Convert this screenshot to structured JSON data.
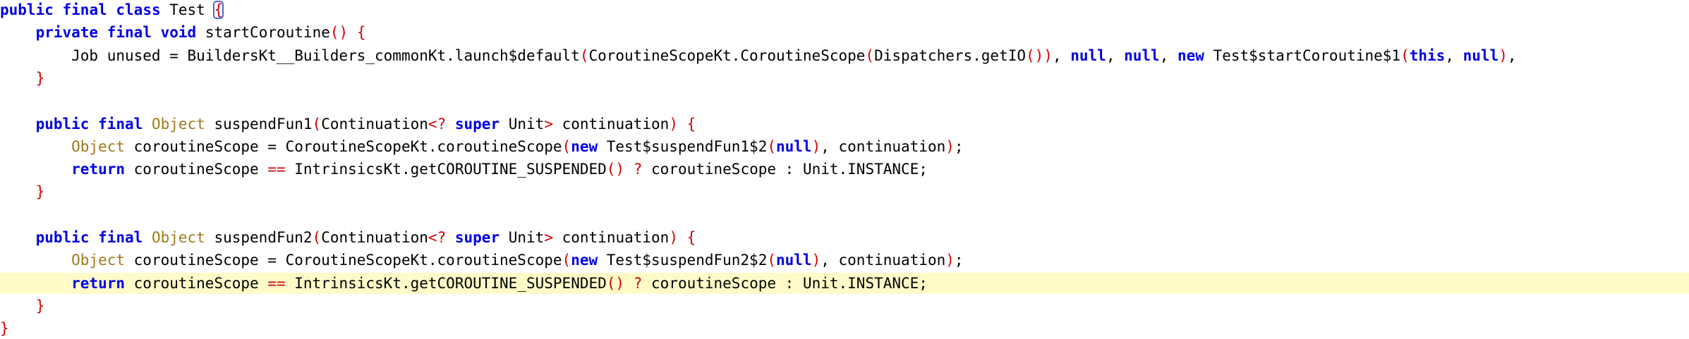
{
  "editor": {
    "current_line": 13,
    "colors": {
      "keyword": "#0000e6",
      "type": "#9e7a1c",
      "paren": "#d20000",
      "plain": "#000000",
      "current_line_bg": "#fffbc9",
      "bracket_match_box": "#4a66c8"
    },
    "lines": [
      [
        {
          "t": "kw",
          "v": "public"
        },
        {
          "t": "plain",
          "v": " "
        },
        {
          "t": "kw",
          "v": "final"
        },
        {
          "t": "plain",
          "v": " "
        },
        {
          "t": "kw",
          "v": "class"
        },
        {
          "t": "plain",
          "v": " Test "
        },
        {
          "t": "paren",
          "v": "{",
          "boxed": true
        }
      ],
      [
        {
          "t": "plain",
          "v": "    "
        },
        {
          "t": "kw",
          "v": "private"
        },
        {
          "t": "plain",
          "v": " "
        },
        {
          "t": "kw",
          "v": "final"
        },
        {
          "t": "plain",
          "v": " "
        },
        {
          "t": "kw",
          "v": "void"
        },
        {
          "t": "plain",
          "v": " startCoroutine"
        },
        {
          "t": "paren",
          "v": "()"
        },
        {
          "t": "plain",
          "v": " "
        },
        {
          "t": "paren",
          "v": "{"
        }
      ],
      [
        {
          "t": "plain",
          "v": "        Job unused = BuildersKt__Builders_commonKt.launch$default"
        },
        {
          "t": "paren",
          "v": "("
        },
        {
          "t": "plain",
          "v": "CoroutineScopeKt.CoroutineScope"
        },
        {
          "t": "paren",
          "v": "("
        },
        {
          "t": "plain",
          "v": "Dispatchers.getIO"
        },
        {
          "t": "paren",
          "v": "())"
        },
        {
          "t": "plain",
          "v": ", "
        },
        {
          "t": "kw",
          "v": "null"
        },
        {
          "t": "plain",
          "v": ", "
        },
        {
          "t": "kw",
          "v": "null"
        },
        {
          "t": "plain",
          "v": ", "
        },
        {
          "t": "kw",
          "v": "new"
        },
        {
          "t": "plain",
          "v": " Test$startCoroutine$1"
        },
        {
          "t": "paren",
          "v": "("
        },
        {
          "t": "kw",
          "v": "this"
        },
        {
          "t": "plain",
          "v": ", "
        },
        {
          "t": "kw",
          "v": "null"
        },
        {
          "t": "paren",
          "v": ")"
        },
        {
          "t": "plain",
          "v": ","
        }
      ],
      [
        {
          "t": "plain",
          "v": "    "
        },
        {
          "t": "paren",
          "v": "}"
        }
      ],
      [],
      [
        {
          "t": "plain",
          "v": "    "
        },
        {
          "t": "kw",
          "v": "public"
        },
        {
          "t": "plain",
          "v": " "
        },
        {
          "t": "kw",
          "v": "final"
        },
        {
          "t": "plain",
          "v": " "
        },
        {
          "t": "type",
          "v": "Object"
        },
        {
          "t": "plain",
          "v": " suspendFun1"
        },
        {
          "t": "paren",
          "v": "("
        },
        {
          "t": "plain",
          "v": "Continuation"
        },
        {
          "t": "paren",
          "v": "<?"
        },
        {
          "t": "plain",
          "v": " "
        },
        {
          "t": "kw",
          "v": "super"
        },
        {
          "t": "plain",
          "v": " Unit"
        },
        {
          "t": "paren",
          "v": ">"
        },
        {
          "t": "plain",
          "v": " continuation"
        },
        {
          "t": "paren",
          "v": ")"
        },
        {
          "t": "plain",
          "v": " "
        },
        {
          "t": "paren",
          "v": "{"
        }
      ],
      [
        {
          "t": "plain",
          "v": "        "
        },
        {
          "t": "type",
          "v": "Object"
        },
        {
          "t": "plain",
          "v": " coroutineScope = CoroutineScopeKt.coroutineScope"
        },
        {
          "t": "paren",
          "v": "("
        },
        {
          "t": "kw",
          "v": "new"
        },
        {
          "t": "plain",
          "v": " Test$suspendFun1$2"
        },
        {
          "t": "paren",
          "v": "("
        },
        {
          "t": "kw",
          "v": "null"
        },
        {
          "t": "paren",
          "v": ")"
        },
        {
          "t": "plain",
          "v": ", continuation"
        },
        {
          "t": "paren",
          "v": ")"
        },
        {
          "t": "plain",
          "v": ";"
        }
      ],
      [
        {
          "t": "plain",
          "v": "        "
        },
        {
          "t": "kw",
          "v": "return"
        },
        {
          "t": "plain",
          "v": " coroutineScope "
        },
        {
          "t": "paren",
          "v": "=="
        },
        {
          "t": "plain",
          "v": " IntrinsicsKt.getCOROUTINE_SUSPENDED"
        },
        {
          "t": "paren",
          "v": "()"
        },
        {
          "t": "plain",
          "v": " "
        },
        {
          "t": "paren",
          "v": "?"
        },
        {
          "t": "plain",
          "v": " coroutineScope : Unit.INSTANCE;"
        }
      ],
      [
        {
          "t": "plain",
          "v": "    "
        },
        {
          "t": "paren",
          "v": "}"
        }
      ],
      [],
      [
        {
          "t": "plain",
          "v": "    "
        },
        {
          "t": "kw",
          "v": "public"
        },
        {
          "t": "plain",
          "v": " "
        },
        {
          "t": "kw",
          "v": "final"
        },
        {
          "t": "plain",
          "v": " "
        },
        {
          "t": "type",
          "v": "Object"
        },
        {
          "t": "plain",
          "v": " suspendFun2"
        },
        {
          "t": "paren",
          "v": "("
        },
        {
          "t": "plain",
          "v": "Continuation"
        },
        {
          "t": "paren",
          "v": "<?"
        },
        {
          "t": "plain",
          "v": " "
        },
        {
          "t": "kw",
          "v": "super"
        },
        {
          "t": "plain",
          "v": " Unit"
        },
        {
          "t": "paren",
          "v": ">"
        },
        {
          "t": "plain",
          "v": " continuation"
        },
        {
          "t": "paren",
          "v": ")"
        },
        {
          "t": "plain",
          "v": " "
        },
        {
          "t": "paren",
          "v": "{"
        }
      ],
      [
        {
          "t": "plain",
          "v": "        "
        },
        {
          "t": "type",
          "v": "Object"
        },
        {
          "t": "plain",
          "v": " coroutineScope = CoroutineScopeKt.coroutineScope"
        },
        {
          "t": "paren",
          "v": "("
        },
        {
          "t": "kw",
          "v": "new"
        },
        {
          "t": "plain",
          "v": " Test$suspendFun2$2"
        },
        {
          "t": "paren",
          "v": "("
        },
        {
          "t": "kw",
          "v": "null"
        },
        {
          "t": "paren",
          "v": ")"
        },
        {
          "t": "plain",
          "v": ", continuation"
        },
        {
          "t": "paren",
          "v": ")"
        },
        {
          "t": "plain",
          "v": ";"
        }
      ],
      [
        {
          "t": "plain",
          "v": "        "
        },
        {
          "t": "kw",
          "v": "return"
        },
        {
          "t": "plain",
          "v": " coroutineScope "
        },
        {
          "t": "paren",
          "v": "=="
        },
        {
          "t": "plain",
          "v": " IntrinsicsKt.getCOROUTINE_SUSPENDED"
        },
        {
          "t": "paren",
          "v": "()"
        },
        {
          "t": "plain",
          "v": " "
        },
        {
          "t": "paren",
          "v": "?"
        },
        {
          "t": "plain",
          "v": " coroutineScope : Unit.INSTANCE;"
        }
      ],
      [
        {
          "t": "plain",
          "v": "    "
        },
        {
          "t": "paren",
          "v": "}"
        }
      ],
      [
        {
          "t": "paren",
          "v": "}"
        }
      ]
    ]
  }
}
